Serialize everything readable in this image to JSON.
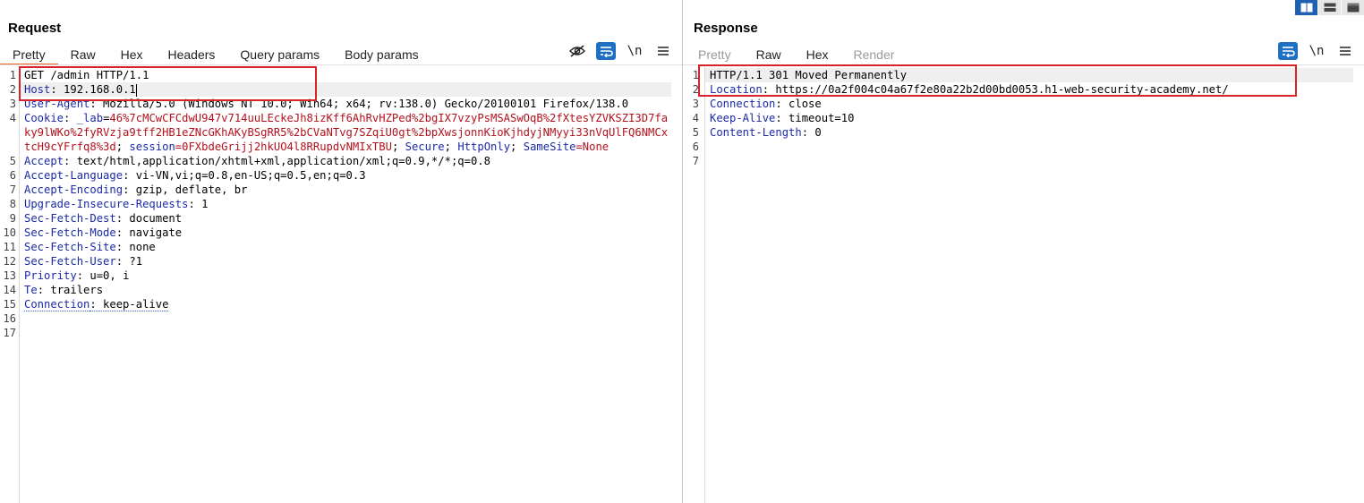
{
  "layout_buttons": [
    {
      "icon": "split-vertical-icon",
      "active": true
    },
    {
      "icon": "split-horizontal-icon",
      "active": false
    },
    {
      "icon": "single-pane-icon",
      "active": false
    }
  ],
  "request": {
    "title": "Request",
    "tabs": [
      "Pretty",
      "Raw",
      "Hex",
      "Headers",
      "Query params",
      "Body params"
    ],
    "active_tab": "Pretty",
    "tools": [
      "hide-nonprintable-icon",
      "wrap-lines-icon",
      "newline-icon",
      "menu-icon"
    ],
    "newline_label": "\\n",
    "lines": {
      "l1": "GET /admin HTTP/1.1",
      "l2k": "Host",
      "l2v": ": 192.168.0.1",
      "l3k": "User-Agent",
      "l3v": ": Mozilla/5.0 (Windows NT 10.0; Win64; x64; rv:138.0) Gecko/20100101 Firefox/138.0",
      "l4k": "Cookie",
      "l4a": ": ",
      "l4n1": "_lab",
      "l4eq": "=",
      "l4v1": "46%7cMCwCFCdwU947v714uuLEckeJh8izKff6AhRvHZPed%2bgIX7vzyPsMSASwOqB%2fXtesYZVKSZI3D7faky9lWKo%2fyRVzja9tff2HB1eZNcGKhAKyBSgRR5%2bCVaNTvg7SZqiU0gt%2bpXwsjonnKioKjhdyjNMyyi33nVqUlFQ6NMCxtcH9cYFrfq8%3d",
      "l4s1": "; ",
      "l4n2": "session",
      "l4v2": "=0FXbdeGrijj2hkUO4l8RRupdvNMIxTBU",
      "l4s2": "; ",
      "l4n3": "Secure",
      "l4s3": "; ",
      "l4n4": "HttpOnly",
      "l4s4": "; ",
      "l4n5": "SameSite",
      "l4v5": "=None",
      "l5k": "Accept",
      "l5v": ": text/html,application/xhtml+xml,application/xml;q=0.9,*/*;q=0.8",
      "l6k": "Accept-Language",
      "l6v": ": vi-VN,vi;q=0.8,en-US;q=0.5,en;q=0.3",
      "l7k": "Accept-Encoding",
      "l7v": ": gzip, deflate, br",
      "l8k": "Upgrade-Insecure-Requests",
      "l8v": ": 1",
      "l9k": "Sec-Fetch-Dest",
      "l9v": ": document",
      "l10k": "Sec-Fetch-Mode",
      "l10v": ": navigate",
      "l11k": "Sec-Fetch-Site",
      "l11v": ": none",
      "l12k": "Sec-Fetch-User",
      "l12v": ": ?1",
      "l13k": "Priority",
      "l13v": ": u=0, i",
      "l14k": "Te",
      "l14v": ": trailers",
      "l15k": "Connection",
      "l15v": ": keep-alive"
    },
    "line_numbers": [
      "1",
      "2",
      "3",
      "4",
      "5",
      "6",
      "7",
      "8",
      "9",
      "10",
      "11",
      "12",
      "13",
      "14",
      "15",
      "16",
      "17"
    ]
  },
  "response": {
    "title": "Response",
    "tabs": [
      "Pretty",
      "Raw",
      "Hex",
      "Render"
    ],
    "active_tab": "Raw",
    "tools": [
      "wrap-lines-icon",
      "newline-icon",
      "menu-icon"
    ],
    "newline_label": "\\n",
    "lines": {
      "l1": "HTTP/1.1 301 Moved Permanently",
      "l2k": "Location",
      "l2v": ": https://0a2f004c04a67f2e80a22b2d00bd0053.h1-web-security-academy.net/",
      "l3k": "Connection",
      "l3v": ": close",
      "l4k": "Keep-Alive",
      "l4v": ": timeout=10",
      "l5k": "Content-Length",
      "l5v": ": 0"
    },
    "line_numbers": [
      "1",
      "2",
      "3",
      "4",
      "5",
      "6",
      "7"
    ]
  }
}
